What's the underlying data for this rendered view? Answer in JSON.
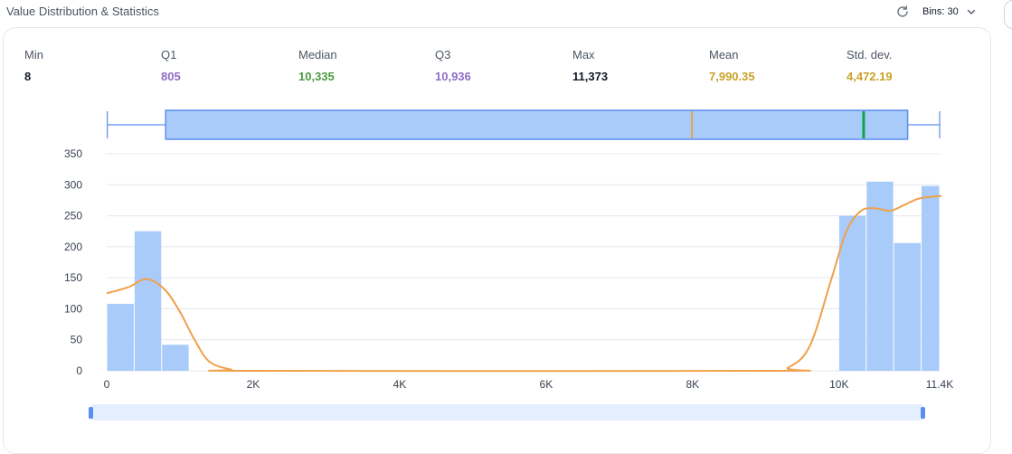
{
  "header": {
    "title": "Value Distribution & Statistics",
    "bins_label": "Bins: 30"
  },
  "stats": [
    {
      "key": "min",
      "label": "Min",
      "value": "8",
      "color": "#111827"
    },
    {
      "key": "q1",
      "label": "Q1",
      "value": "805",
      "color": "#8e6cc4"
    },
    {
      "key": "median",
      "label": "Median",
      "value": "10,335",
      "color": "#4a9a3f"
    },
    {
      "key": "q3",
      "label": "Q3",
      "value": "10,936",
      "color": "#8e6cc4"
    },
    {
      "key": "max",
      "label": "Max",
      "value": "11,373",
      "color": "#111827"
    },
    {
      "key": "mean",
      "label": "Mean",
      "value": "7,990.35",
      "color": "#c9a227"
    },
    {
      "key": "std",
      "label": "Std. dev.",
      "value": "4,472.19",
      "color": "#c9a227"
    }
  ],
  "colors": {
    "bar": "#a8cbfa",
    "box_fill": "#a8cbfa",
    "box_stroke": "#5b8def",
    "mean_line": "#e8a04a",
    "median_line": "#16a34a",
    "density": "#f0a04b",
    "grid": "#e5e7eb",
    "slider_fill": "#e3efff",
    "slider_handle": "#5b8def"
  },
  "chart_data": {
    "type": "bar",
    "bins": [
      {
        "x0": 0,
        "x1": 375,
        "count": 108
      },
      {
        "x0": 375,
        "x1": 750,
        "count": 225
      },
      {
        "x0": 750,
        "x1": 1125,
        "count": 42
      },
      {
        "x0": 9995,
        "x1": 10370,
        "count": 250
      },
      {
        "x0": 10370,
        "x1": 10745,
        "count": 305
      },
      {
        "x0": 10745,
        "x1": 11120,
        "count": 206
      },
      {
        "x0": 11120,
        "x1": 11373,
        "count": 298
      }
    ],
    "density_curve": [
      [
        0,
        125
      ],
      [
        300,
        135
      ],
      [
        550,
        148
      ],
      [
        800,
        130
      ],
      [
        1000,
        95
      ],
      [
        1200,
        50
      ],
      [
        1400,
        15
      ],
      [
        1700,
        2
      ],
      [
        2000,
        0
      ],
      [
        9000,
        0
      ],
      [
        9300,
        5
      ],
      [
        9600,
        40
      ],
      [
        9900,
        150
      ],
      [
        10100,
        225
      ],
      [
        10300,
        258
      ],
      [
        10500,
        262
      ],
      [
        10700,
        258
      ],
      [
        10900,
        268
      ],
      [
        11100,
        278
      ],
      [
        11400,
        282
      ]
    ],
    "boxplot": {
      "min": 8,
      "q1": 805,
      "median": 10335,
      "q3": 10936,
      "max": 11373,
      "mean": 7990.35
    },
    "x_ticks": [
      {
        "value": 0,
        "label": "0"
      },
      {
        "value": 2000,
        "label": "2K"
      },
      {
        "value": 4000,
        "label": "4K"
      },
      {
        "value": 6000,
        "label": "6K"
      },
      {
        "value": 8000,
        "label": "8K"
      },
      {
        "value": 10000,
        "label": "10K"
      },
      {
        "value": 11373,
        "label": "11.4K"
      }
    ],
    "y_ticks": [
      0,
      50,
      100,
      150,
      200,
      250,
      300,
      350
    ],
    "xlim": [
      0,
      11373
    ],
    "ylim": [
      0,
      350
    ],
    "grid": true,
    "xlabel": "",
    "ylabel": ""
  }
}
